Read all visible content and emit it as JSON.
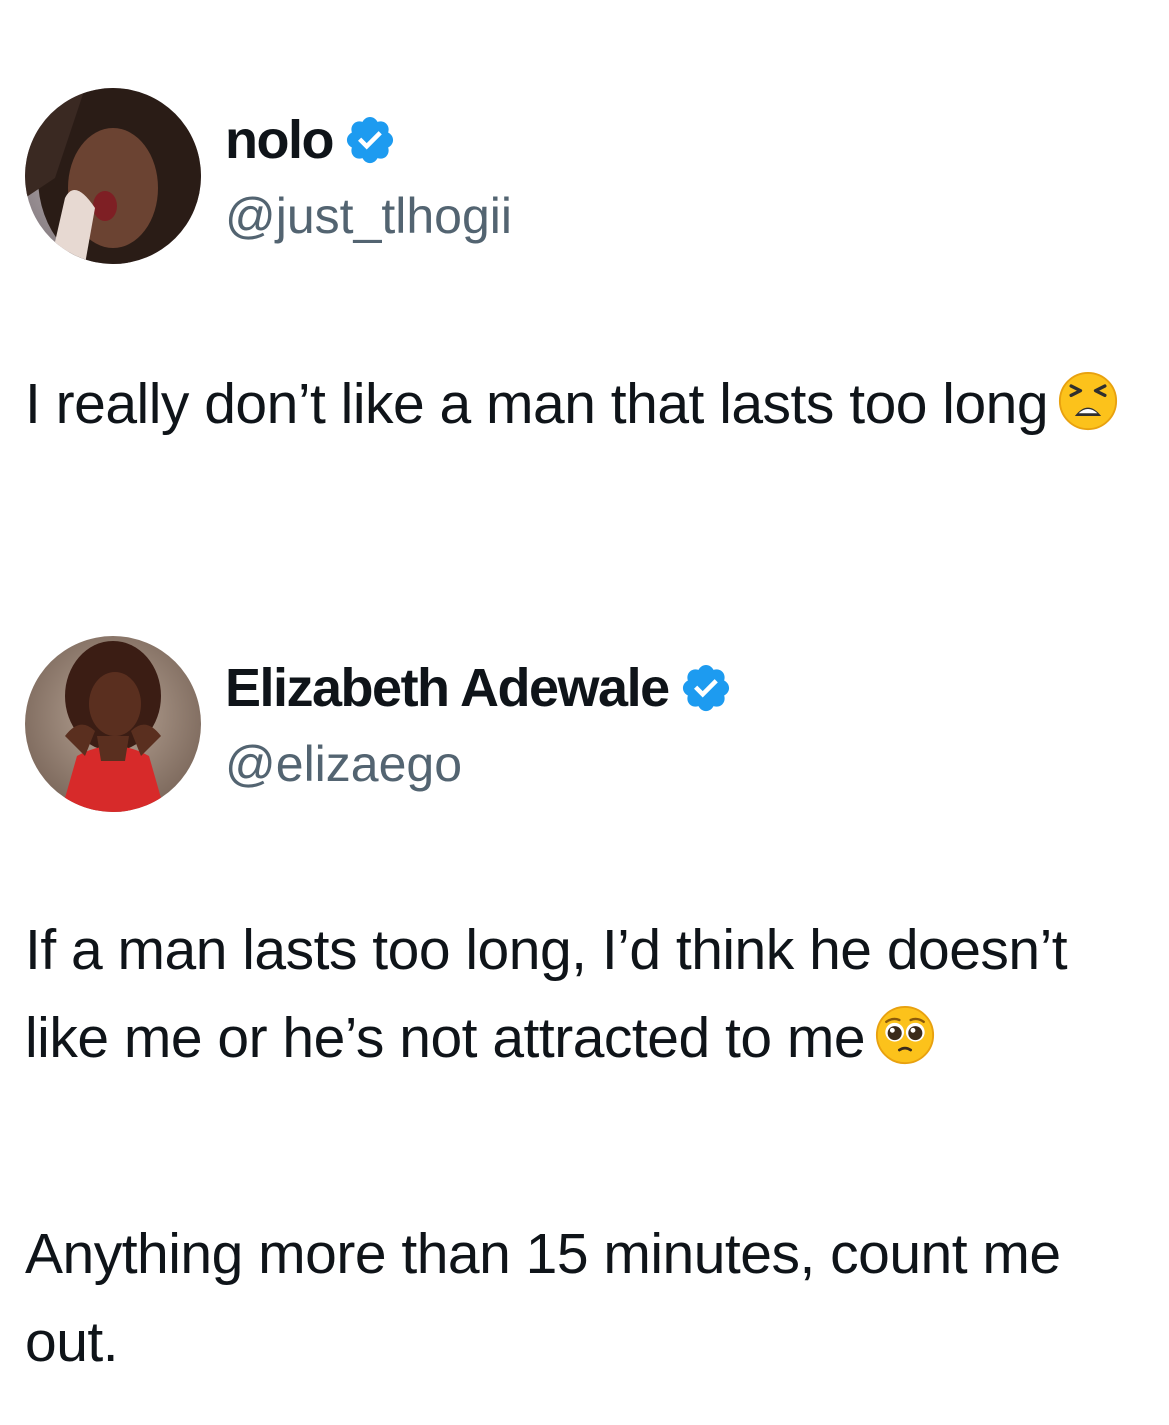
{
  "tweets": [
    {
      "display_name": "nolo",
      "verified": true,
      "handle": "@just_tlhogii",
      "avatar_icon": "user-avatar-photo",
      "text": "I really don’t like a man that lasts too long",
      "emoji": "tired-face-emoji"
    },
    {
      "display_name": "Elizabeth Adewale",
      "verified": true,
      "handle": "@elizaego",
      "avatar_icon": "user-avatar-photo",
      "paragraphs": [
        "If a man lasts too long, I’d think he doesn’t like me or he’s not attracted to me",
        "Anything more than 15 minutes, count me out."
      ],
      "emoji": "pleading-face-emoji"
    }
  ],
  "colors": {
    "text": "#0f1419",
    "handle": "#536471",
    "verified_badge": "#1d9bf0"
  }
}
